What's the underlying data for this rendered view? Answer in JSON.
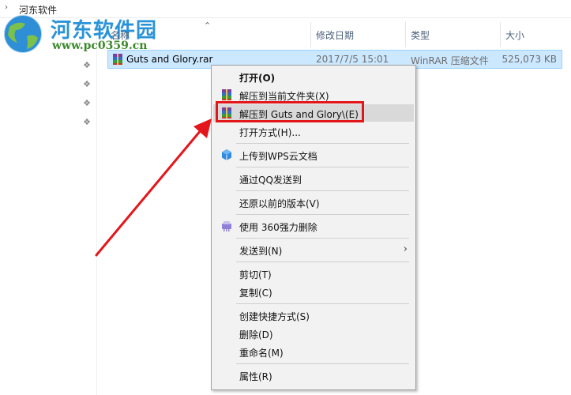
{
  "breadcrumb": {
    "folder": "河东软件"
  },
  "watermark": {
    "brand": "河东软件园",
    "url": "www.pc0359.cn"
  },
  "columns": {
    "name": "名称",
    "date": "修改日期",
    "type": "类型",
    "size": "大小"
  },
  "file": {
    "name": "Guts and Glory.rar",
    "date": "2017/7/5 15:01",
    "type": "WinRAR 压缩文件",
    "size": "525,073 KB"
  },
  "menu": {
    "open": "打开(O)",
    "extract_here": "解压到当前文件夹(X)",
    "extract_to": "解压到 Guts and Glory\\(E)",
    "open_with": "打开方式(H)...",
    "upload_wps": "上传到WPS云文档",
    "send_qq": "通过QQ发送到",
    "restore": "还原以前的版本(V)",
    "delete_360": "使用 360强力删除",
    "send_to": "发送到(N)",
    "cut": "剪切(T)",
    "copy": "复制(C)",
    "shortcut": "创建快捷方式(S)",
    "delete": "删除(D)",
    "rename": "重命名(M)",
    "properties": "属性(R)"
  },
  "colors": {
    "highlight_box": "#e3171b",
    "arrow": "#e3171b",
    "selection": "#cce8ff"
  }
}
